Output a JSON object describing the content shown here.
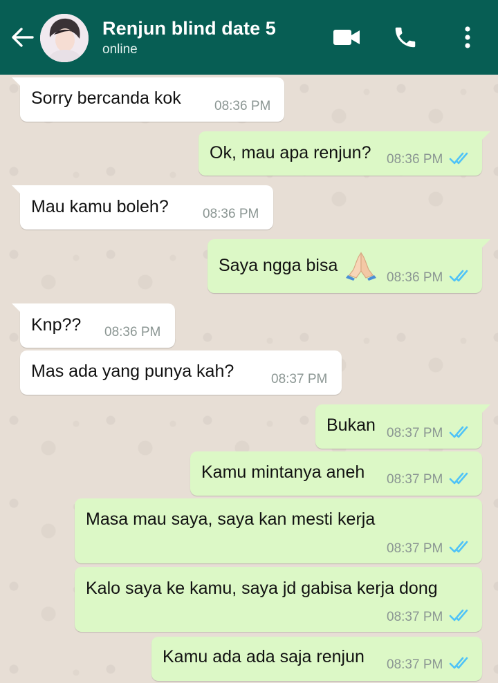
{
  "header": {
    "title": "Renjun blind date 5",
    "status": "online",
    "colors": {
      "bar": "#075e54",
      "icons": "#ffffff"
    },
    "icons": [
      "back-arrow-icon",
      "video-call-icon",
      "phone-icon",
      "more-vert-icon"
    ]
  },
  "chat": {
    "colors": {
      "incoming": "#ffffff",
      "outgoing": "#dcf8c6",
      "read_ticks": "#4fc3f7",
      "time": "#8b9693"
    },
    "messages": [
      {
        "dir": "in",
        "text": "Sorry bercanda kok",
        "time": "08:36 PM"
      },
      {
        "dir": "out",
        "text": "Ok, mau apa renjun?",
        "time": "08:36 PM",
        "read": true
      },
      {
        "dir": "in",
        "text": "Mau kamu boleh?",
        "time": "08:36 PM"
      },
      {
        "dir": "out",
        "text": "Saya ngga bisa",
        "emoji": "folded-hands-emoji",
        "time": "08:36 PM",
        "read": true
      },
      {
        "dir": "in",
        "text": "Knp??",
        "time": "08:36 PM"
      },
      {
        "dir": "in",
        "text": "Mas ada yang punya kah?",
        "time": "08:37 PM"
      },
      {
        "dir": "out",
        "text": "Bukan",
        "time": "08:37 PM",
        "read": true
      },
      {
        "dir": "out",
        "text": "Kamu mintanya aneh",
        "time": "08:37 PM",
        "read": true
      },
      {
        "dir": "out",
        "text": "Masa mau saya, saya kan mesti kerja",
        "time": "08:37 PM",
        "read": true
      },
      {
        "dir": "out",
        "text": "Kalo saya ke kamu, saya jd gabisa kerja dong",
        "time": "08:37 PM",
        "read": true
      },
      {
        "dir": "out",
        "text": "Kamu ada ada saja renjun",
        "time": "08:37 PM",
        "read": true
      }
    ]
  }
}
